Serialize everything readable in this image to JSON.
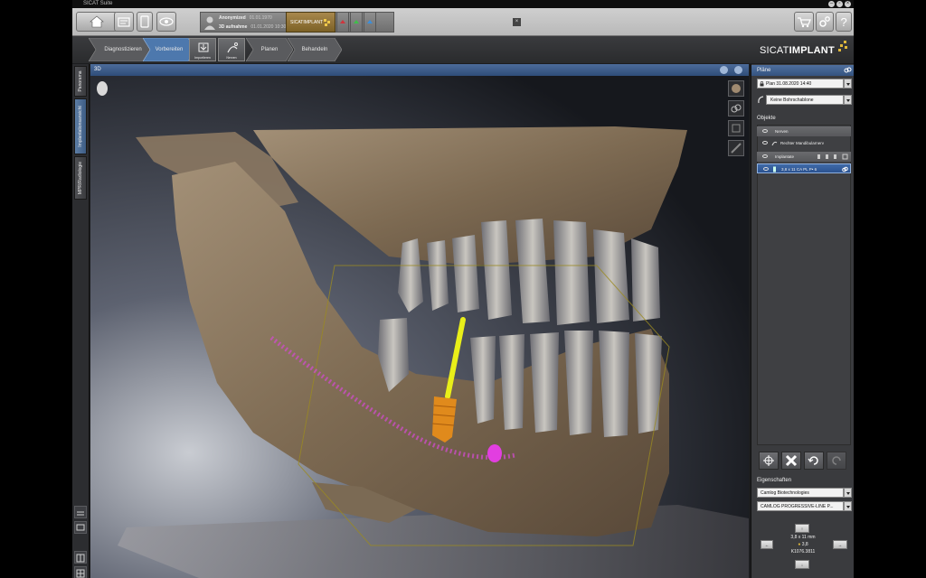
{
  "window": {
    "title": "SICAT Suite"
  },
  "toolbar": {
    "patient_name": "Anonymized",
    "patient_date": "01.01.1970",
    "volume_label": "3D aufnahme",
    "volume_date": "01.01.2020 10:30",
    "app_tab": "SICATIMPLANT"
  },
  "workflow": {
    "steps": [
      {
        "label": "Diagnostizieren"
      },
      {
        "label": "Vorbereiten"
      },
      {
        "label": "Planen"
      },
      {
        "label": "Behandeln"
      }
    ],
    "tools": [
      {
        "label": "Importieren"
      },
      {
        "label": "Nerven"
      }
    ]
  },
  "brand": {
    "prefix": "SICAT",
    "suffix": "IMPLANT"
  },
  "left_tabs": [
    "Panorama",
    "Implantationsansicht",
    "MPR/Radiologie"
  ],
  "viewport": {
    "title": "3D"
  },
  "panel": {
    "plans_title": "Pläne",
    "plan_selected": "Plan 31.08.2020 14:40",
    "template_selected": "Keine Bohrschablone",
    "objects_title": "Objekte",
    "objects": [
      {
        "label": "Nerven",
        "group": true
      },
      {
        "label": "Rechter Mandibularnerv",
        "group": false
      },
      {
        "label": "Implantate",
        "group": true
      },
      {
        "label": "3,8 x 11 CA PL P• 6",
        "group": false,
        "selected": true
      }
    ],
    "properties_title": "Eigenschaften",
    "manufacturer": "Camlog Biotechnologies",
    "product_line": "CAMLOG PROGRESSIVE-LINE P...",
    "implant_size": "3,8 x 11 mm",
    "implant_sub": "3,8",
    "implant_code": "K1076.3811"
  },
  "colors": {
    "accent_blue": "#3e5d85",
    "implant_orange": "#e08a1c",
    "drill_yellow": "#e9ef19",
    "nerve_magenta": "#d04ccc",
    "brand_gold": "#e0b83a"
  }
}
